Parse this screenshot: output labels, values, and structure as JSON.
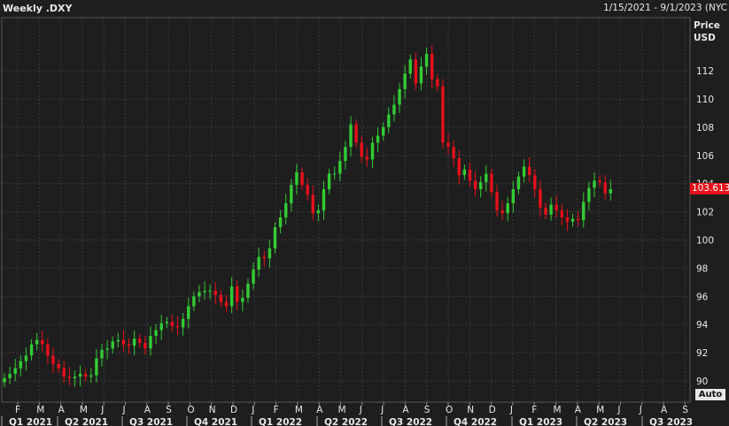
{
  "header": {
    "title": "Weekly .DXY",
    "date_range": "1/15/2021 - 9/1/2023 (NYC"
  },
  "axis": {
    "price_label": "Price",
    "currency_label": "USD"
  },
  "controls": {
    "auto_label": "Auto"
  },
  "last_price": "103.613",
  "colors": {
    "background": "#1e1e1e",
    "grid": "#3a3a3a",
    "up": "#33cc33",
    "down": "#e8101a"
  },
  "chart_data": {
    "type": "candlestick",
    "ylim": [
      89,
      115
    ],
    "yticks": [
      90,
      92,
      94,
      96,
      98,
      100,
      102,
      104,
      106,
      108,
      110,
      112
    ],
    "x_month_labels": [
      "F",
      "M",
      "A",
      "M",
      "J",
      "J",
      "A",
      "S",
      "O",
      "N",
      "D",
      "J",
      "F",
      "M",
      "A",
      "M",
      "J",
      "J",
      "A",
      "S",
      "O",
      "N",
      "D",
      "J",
      "F",
      "M",
      "A",
      "M",
      "J",
      "J",
      "A",
      "S"
    ],
    "x_quarter_labels": [
      "Q1 2021",
      "Q2 2021",
      "Q3 2021",
      "Q4 2021",
      "Q1 2022",
      "Q2 2022",
      "Q3 2022",
      "Q4 2022",
      "Q1 2023",
      "Q2 2023",
      "Q3 2023"
    ],
    "grid": true,
    "close_series": [
      90.2,
      90.5,
      90.9,
      91.4,
      91.8,
      92.6,
      92.9,
      92.6,
      91.8,
      91.2,
      90.9,
      90.3,
      90.2,
      90.3,
      90.5,
      90.3,
      90.4,
      91.6,
      92.2,
      92.3,
      92.8,
      92.9,
      92.6,
      92.5,
      93.0,
      92.7,
      92.3,
      93.2,
      93.6,
      94.1,
      94.2,
      93.9,
      93.8,
      94.4,
      95.3,
      96.0,
      96.3,
      96.4,
      96.4,
      96.1,
      95.6,
      95.3,
      96.7,
      95.6,
      95.9,
      96.9,
      97.9,
      98.8,
      98.7,
      99.4,
      100.9,
      101.6,
      102.6,
      103.9,
      104.8,
      103.9,
      103.2,
      101.9,
      102.1,
      103.6,
      104.7,
      104.7,
      105.6,
      106.6,
      108.2,
      106.9,
      105.9,
      105.7,
      106.9,
      107.4,
      108.0,
      108.9,
      109.6,
      110.7,
      111.8,
      112.8,
      111.1,
      112.3,
      113.2,
      111.4,
      110.9,
      106.9,
      106.6,
      105.8,
      104.6,
      105.0,
      104.2,
      103.6,
      104.1,
      104.7,
      103.4,
      102.1,
      101.9,
      102.6,
      103.6,
      104.5,
      105.2,
      104.6,
      103.6,
      102.3,
      101.8,
      102.5,
      102.1,
      101.6,
      101.3,
      101.5,
      101.4,
      102.7,
      103.7,
      104.2,
      104.1,
      103.3,
      103.6
    ],
    "last_value": 103.613,
    "price_unit": "USD"
  }
}
